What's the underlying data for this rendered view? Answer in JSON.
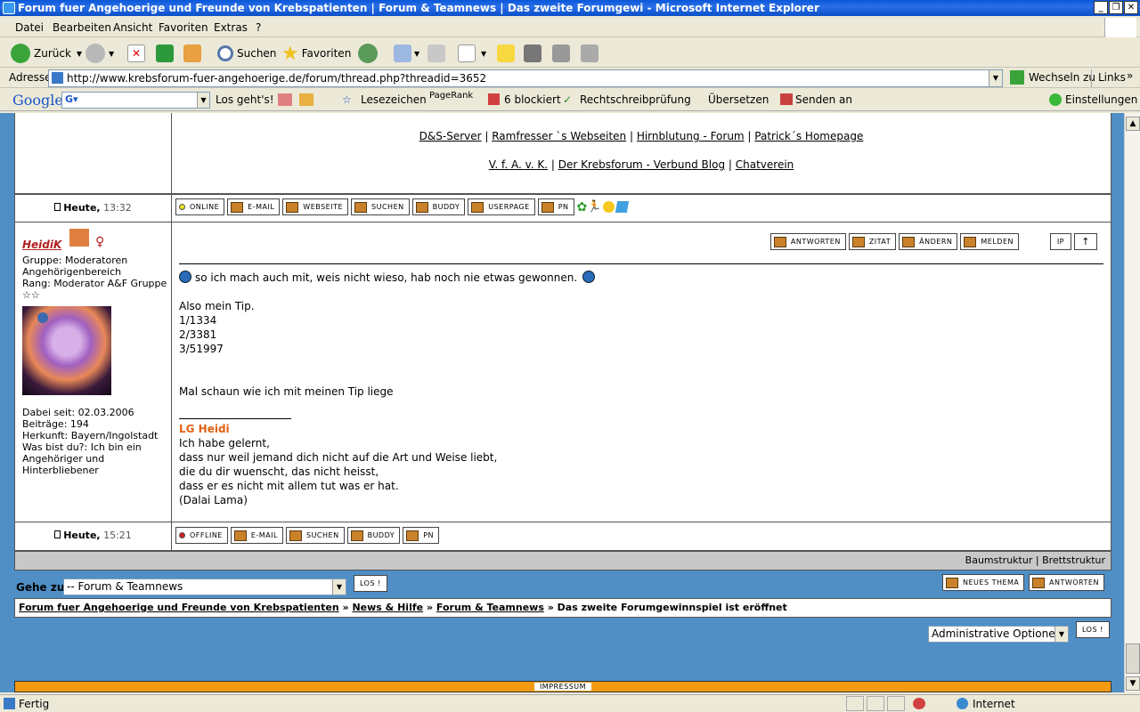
{
  "window": {
    "title": "Forum fuer Angehoerige und Freunde von Krebspatienten | Forum & Teamnews | Das zweite Forumgewi - Microsoft Internet Explorer"
  },
  "menu": [
    "Datei",
    "Bearbeiten",
    "Ansicht",
    "Favoriten",
    "Extras",
    "?"
  ],
  "toolbar": {
    "back": "Zurück",
    "search": "Suchen",
    "favorites": "Favoriten"
  },
  "address": {
    "label": "Adresse",
    "url": "http://www.krebsforum-fuer-angehoerige.de/forum/thread.php?threadid=3652",
    "go": "Wechseln zu",
    "links": "Links"
  },
  "google": {
    "logo": "Google",
    "search_btn": "Los geht's!",
    "bookmarks": "Lesezeichen",
    "pagerank": "PageRank",
    "blocked": "6 blockiert",
    "spell": "Rechtschreibprüfung",
    "translate": "Übersetzen",
    "send": "Senden an",
    "settings": "Einstellungen"
  },
  "links_row1": [
    "D&S-Server",
    "Ramfresser `s Webseiten",
    "Hirnblutung - Forum",
    "Patrick´s Homepage"
  ],
  "links_row2": [
    "V. f. A. v. K.",
    "Der Krebsforum - Verbund Blog",
    "Chatverein"
  ],
  "post1_footer": {
    "date": "Heute,",
    "time": "13:32",
    "buttons": [
      "ONLINE",
      "E-MAIL",
      "WEBSEITE",
      "SUCHEN",
      "BUDDY",
      "USERPAGE",
      "PN"
    ]
  },
  "post2": {
    "author": "HeidiK",
    "group": "Gruppe: Moderatoren Angehörigenbereich",
    "rank": "Rang: Moderator A&F Gruppe",
    "stars": "☆☆",
    "joined": "Dabei seit: 02.03.2006",
    "posts": "Beiträge: 194",
    "origin": "Herkunft: Bayern/Ingolstadt",
    "who": "Was bist du?: Ich bin ein Angehöriger und Hinterbliebener",
    "actions": [
      "ANTWORTEN",
      "ZITAT",
      "ÄNDERN",
      "MELDEN"
    ],
    "ip": "IP",
    "up": "↑",
    "lines": [
      "so ich mach auch mit, weis nicht wieso, hab noch nie etwas gewonnen.",
      "",
      "Also mein Tip.",
      "1/1334",
      "2/3381",
      "3/51997",
      "",
      "",
      "Mal schaun wie ich mit meinen Tip liege"
    ],
    "sig_name": "LG Heidi",
    "sig_lines": [
      "Ich habe gelernt,",
      "dass nur weil jemand dich nicht auf die Art und Weise liebt,",
      "die du dir wuenscht, das nicht heisst,",
      "dass er es nicht mit allem tut was er hat.",
      "(Dalai Lama)"
    ],
    "footer_date": "Heute,",
    "footer_time": "15:21",
    "footer_buttons": [
      "OFFLINE",
      "E-MAIL",
      "SUCHEN",
      "BUDDY",
      "PN"
    ]
  },
  "bottom": {
    "tree": "Baumstruktur",
    "board": "Brettstruktur",
    "goto": "Gehe zu:",
    "goto_value": "-- Forum & Teamnews",
    "go": "LOS !",
    "new_thread": "NEUES THEMA",
    "reply": "ANTWORTEN",
    "breadcrumb": [
      "Forum fuer Angehoerige und Freunde von Krebspatienten",
      "News & Hilfe",
      "Forum & Teamnews"
    ],
    "breadcrumb_current": "Das zweite Forumgewinnspiel ist eröffnet",
    "sep": "»",
    "admin": "Administrative Optionen:",
    "impressum": "IMPRESSUM"
  },
  "status": {
    "text": "Fertig",
    "zone": "Internet"
  }
}
